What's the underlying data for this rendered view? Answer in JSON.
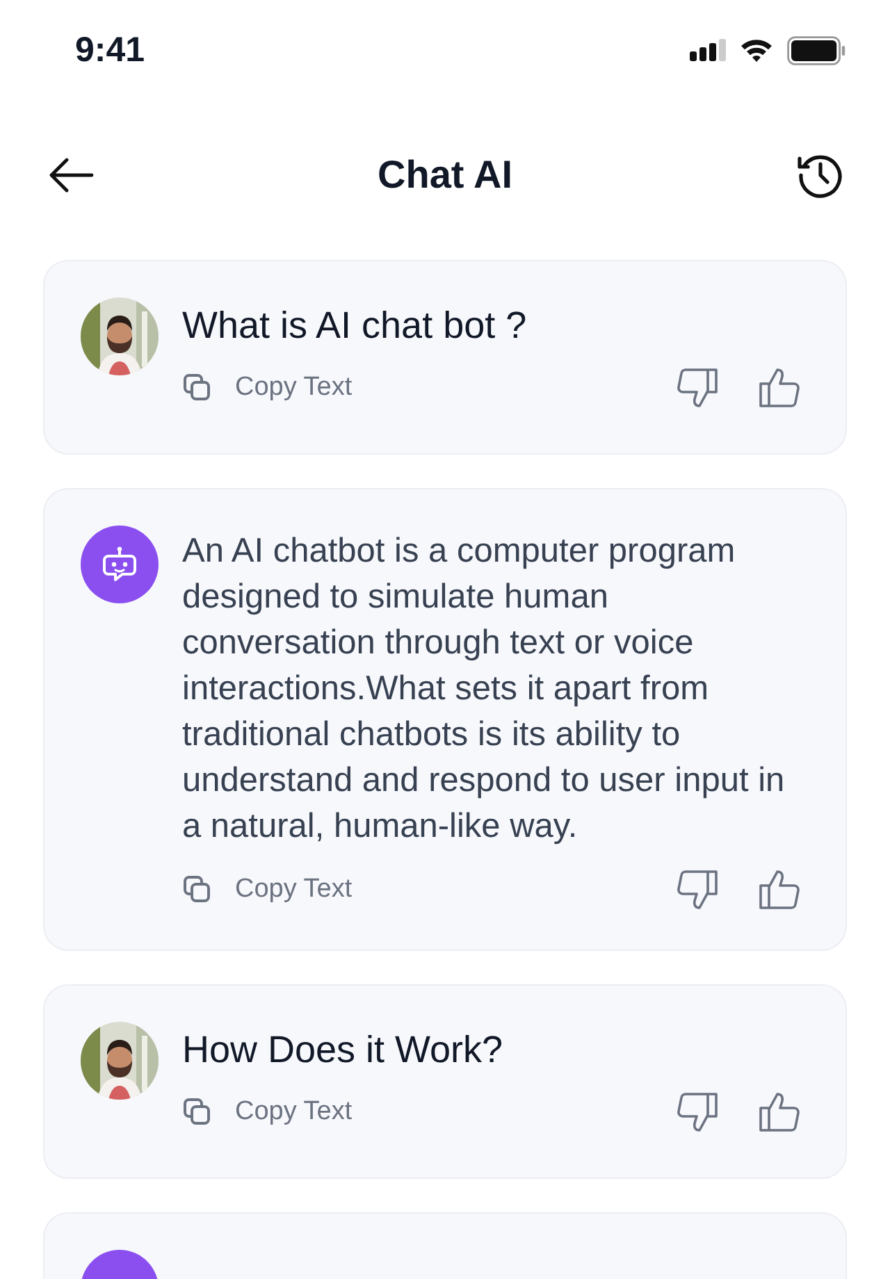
{
  "status_bar": {
    "time": "9:41"
  },
  "header": {
    "title": "Chat AI"
  },
  "messages": [
    {
      "kind": "user",
      "text": "What is AI chat bot ?",
      "copy_label": "Copy Text"
    },
    {
      "kind": "bot",
      "text": "An AI chatbot is a computer program designed to simulate human conversation through text or voice interactions.What sets it apart from traditional chatbots is its ability to understand and respond to user input in a natural, human-like way.",
      "copy_label": "Copy Text"
    },
    {
      "kind": "user",
      "text": "How Does it Work?",
      "copy_label": "Copy Text"
    },
    {
      "kind": "bot"
    }
  ]
}
